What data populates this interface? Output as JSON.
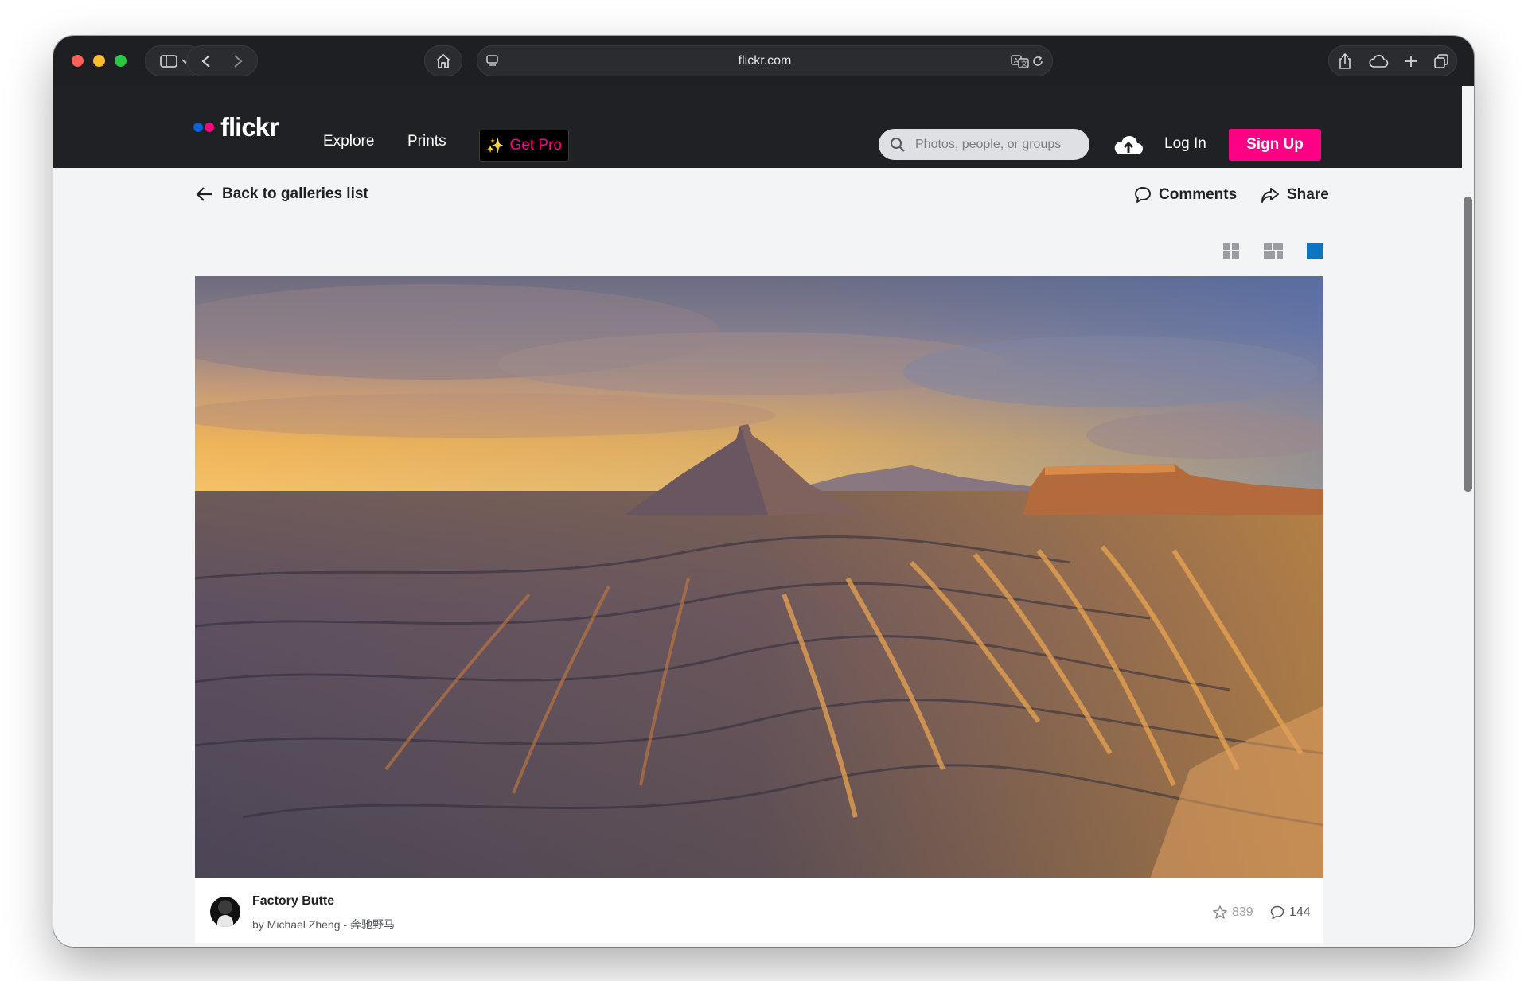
{
  "browser": {
    "url": "flickr.com"
  },
  "nav": {
    "logo": "flickr",
    "explore": "Explore",
    "prints": "Prints",
    "get_pro": "Get Pro",
    "search_placeholder": "Photos, people, or groups",
    "login": "Log In",
    "signup": "Sign Up"
  },
  "page": {
    "back": "Back to galleries list",
    "comments": "Comments",
    "share": "Share",
    "view_modes": [
      "small-grid",
      "medium-grid",
      "large"
    ],
    "active_view": "large"
  },
  "photo": {
    "title": "Factory Butte",
    "author": "by Michael Zheng - 奔驰野马",
    "faves": "839",
    "comments": "144"
  },
  "colors": {
    "brand_pink": "#ff0084",
    "brand_blue": "#0063dc",
    "nav_bg": "#202124",
    "active_view": "#0e76c0"
  }
}
